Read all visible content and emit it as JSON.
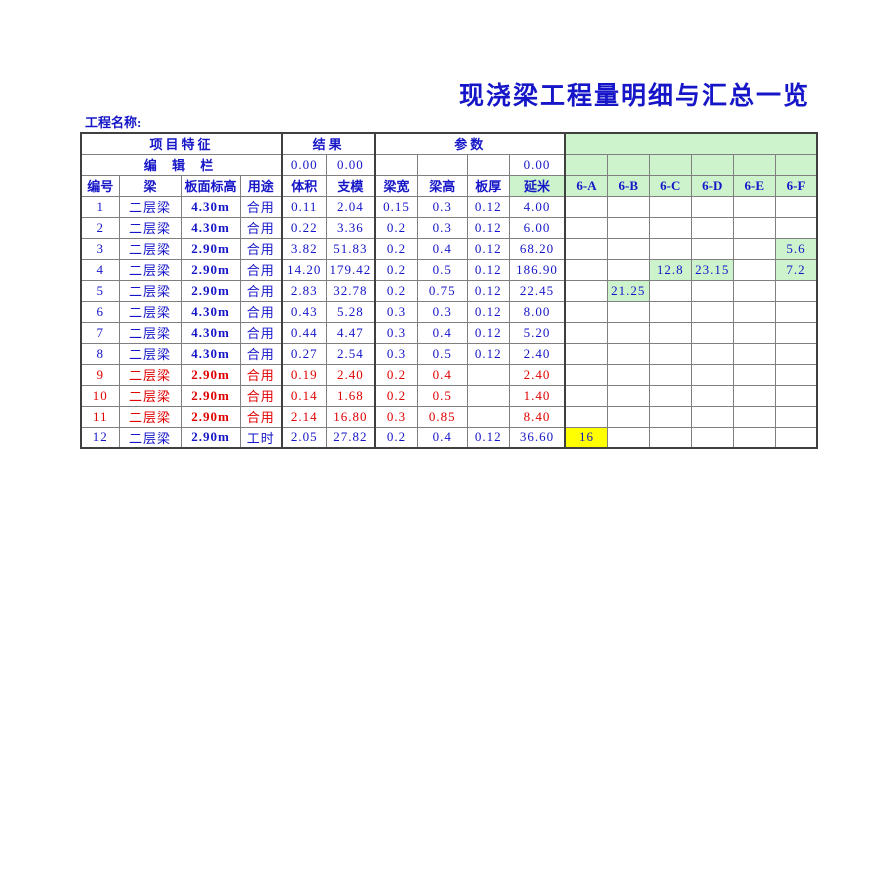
{
  "document": {
    "title": "现浇梁工程量明细与汇总一览",
    "project_label": "工程名称:"
  },
  "table": {
    "group_headers": {
      "feature": "项目特征",
      "result": "结果",
      "parameter": "参数",
      "blank": ""
    },
    "edit_row": {
      "label": "编  辑  栏",
      "volume": "0.00",
      "formwork": "0.00",
      "beam_width": "",
      "beam_height": "",
      "slab_thickness": "",
      "length": "0.00"
    },
    "columns": [
      "编号",
      "梁",
      "板面标高",
      "用途",
      "体积",
      "支模",
      "梁宽",
      "梁高",
      "板厚",
      "延米",
      "6-A",
      "6-B",
      "6-C",
      "6-D",
      "6-E",
      "6-F"
    ],
    "rows": [
      {
        "no": "1",
        "beam": "二层梁",
        "elev": "4.30m",
        "use": "合用",
        "volume": "0.11",
        "formwork": "2.04",
        "bw": "0.15",
        "bh": "0.3",
        "slab": "0.12",
        "length": "4.00",
        "g": [
          "",
          "",
          "",
          "",
          "",
          ""
        ],
        "volume_small": false,
        "formwork_small": false,
        "red": false
      },
      {
        "no": "2",
        "beam": "二层梁",
        "elev": "4.30m",
        "use": "合用",
        "volume": "0.22",
        "formwork": "3.36",
        "bw": "0.2",
        "bh": "0.3",
        "slab": "0.12",
        "length": "6.00",
        "g": [
          "",
          "",
          "",
          "",
          "",
          ""
        ],
        "volume_small": false,
        "formwork_small": true,
        "red": false
      },
      {
        "no": "3",
        "beam": "二层梁",
        "elev": "2.90m",
        "use": "合用",
        "volume": "3.82",
        "formwork": "51.83",
        "bw": "0.2",
        "bh": "0.4",
        "slab": "0.12",
        "length": "68.20",
        "g": [
          "",
          "",
          "",
          "",
          "",
          "5.6"
        ],
        "volume_small": false,
        "formwork_small": true,
        "red": false
      },
      {
        "no": "4",
        "beam": "二层梁",
        "elev": "2.90m",
        "use": "合用",
        "volume": "14.20",
        "formwork": "179.42",
        "bw": "0.2",
        "bh": "0.5",
        "slab": "0.12",
        "length": "186.90",
        "g": [
          "",
          "",
          "12.8",
          "23.15",
          "",
          "7.2"
        ],
        "volume_small": true,
        "formwork_small": true,
        "red": false
      },
      {
        "no": "5",
        "beam": "二层梁",
        "elev": "2.90m",
        "use": "合用",
        "volume": "2.83",
        "formwork": "32.78",
        "bw": "0.2",
        "bh": "0.75",
        "slab": "0.12",
        "length": "22.45",
        "g": [
          "",
          "21.25",
          "",
          "",
          "",
          ""
        ],
        "volume_small": false,
        "formwork_small": true,
        "red": false
      },
      {
        "no": "6",
        "beam": "二层梁",
        "elev": "4.30m",
        "use": "合用",
        "volume": "0.43",
        "formwork": "5.28",
        "bw": "0.3",
        "bh": "0.3",
        "slab": "0.12",
        "length": "8.00",
        "g": [
          "",
          "",
          "",
          "",
          "",
          ""
        ],
        "volume_small": false,
        "formwork_small": false,
        "red": false
      },
      {
        "no": "7",
        "beam": "二层梁",
        "elev": "4.30m",
        "use": "合用",
        "volume": "0.44",
        "formwork": "4.47",
        "bw": "0.3",
        "bh": "0.4",
        "slab": "0.12",
        "length": "5.20",
        "g": [
          "",
          "",
          "",
          "",
          "",
          ""
        ],
        "volume_small": false,
        "formwork_small": false,
        "red": false
      },
      {
        "no": "8",
        "beam": "二层梁",
        "elev": "4.30m",
        "use": "合用",
        "volume": "0.27",
        "formwork": "2.54",
        "bw": "0.3",
        "bh": "0.5",
        "slab": "0.12",
        "length": "2.40",
        "g": [
          "",
          "",
          "",
          "",
          "",
          ""
        ],
        "volume_small": false,
        "formwork_small": false,
        "red": false
      },
      {
        "no": "9",
        "beam": "二层梁",
        "elev": "2.90m",
        "use": "合用",
        "volume": "0.19",
        "formwork": "2.40",
        "bw": "0.2",
        "bh": "0.4",
        "slab": "",
        "length": "2.40",
        "g": [
          "",
          "",
          "",
          "",
          "",
          ""
        ],
        "volume_small": false,
        "formwork_small": false,
        "red": true
      },
      {
        "no": "10",
        "beam": "二层梁",
        "elev": "2.90m",
        "use": "合用",
        "volume": "0.14",
        "formwork": "1.68",
        "bw": "0.2",
        "bh": "0.5",
        "slab": "",
        "length": "1.40",
        "g": [
          "",
          "",
          "",
          "",
          "",
          ""
        ],
        "volume_small": false,
        "formwork_small": false,
        "red": true
      },
      {
        "no": "11",
        "beam": "二层梁",
        "elev": "2.90m",
        "use": "合用",
        "volume": "2.14",
        "formwork": "16.80",
        "bw": "0.3",
        "bh": "0.85",
        "slab": "",
        "length": "8.40",
        "g": [
          "",
          "",
          "",
          "",
          "",
          ""
        ],
        "volume_small": false,
        "formwork_small": true,
        "red": true
      },
      {
        "no": "12",
        "beam": "二层梁",
        "elev": "2.90m",
        "use": "工时",
        "volume": "2.05",
        "formwork": "27.82",
        "bw": "0.2",
        "bh": "0.4",
        "slab": "0.12",
        "length": "36.60",
        "g": [
          "16",
          "",
          "",
          "",
          "",
          ""
        ],
        "volume_small": false,
        "formwork_small": true,
        "red": false
      }
    ],
    "highlight": {
      "green": "#ccf3cc",
      "yellow": "#ffff00",
      "text": "#1616c8",
      "red_text": "#e00000"
    }
  }
}
